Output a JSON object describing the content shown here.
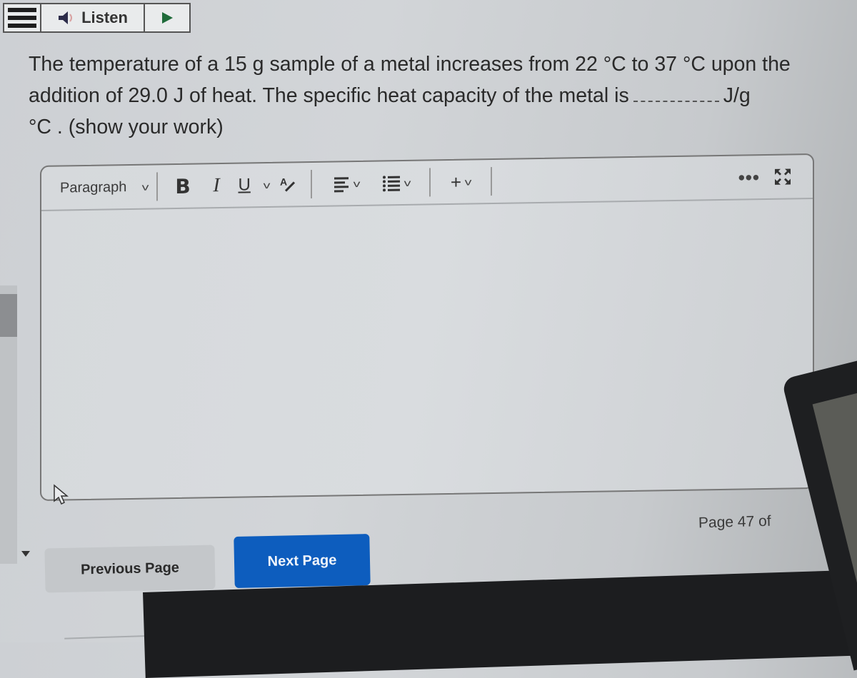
{
  "listen_bar": {
    "menu_icon": "hamburger-menu-icon",
    "speaker_icon": "speaker-icon",
    "listen_label": "Listen",
    "play_icon": "play-icon"
  },
  "question": {
    "line1": "The temperature of a 15 g sample of a metal increases from 22 °C to 37 °C upon the",
    "line2_before_blank": "addition of 29.0 J of heat.  The specific heat capacity of the metal is",
    "line2_after_blank": "J/g",
    "line3": "°C . (show your work)"
  },
  "editor": {
    "block_format": "Paragraph",
    "toolbar": {
      "bold_label": "B",
      "italic_label": "I",
      "underline_label": "U",
      "more_label": "•••",
      "insert_label": "+"
    },
    "content": ""
  },
  "navigation": {
    "previous_label": "Previous Page",
    "next_label": "Next Page",
    "page_indicator": "Page 47 of"
  },
  "colors": {
    "next_button": "#0d5dbe",
    "previous_button": "#c4c7ca"
  }
}
